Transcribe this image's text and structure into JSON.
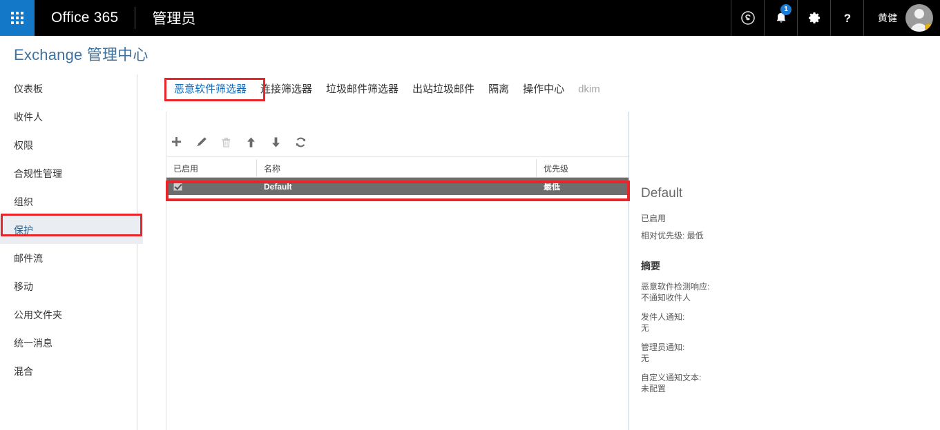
{
  "topbar": {
    "waffle_label": "app-launcher",
    "brand": "Office 365",
    "subbrand": "管理员",
    "icons": [
      {
        "name": "skype-icon",
        "label": "Skype"
      },
      {
        "name": "bell-icon",
        "label": "通知",
        "badge": "1"
      },
      {
        "name": "gear-icon",
        "label": "设置"
      },
      {
        "name": "help-icon",
        "label": "帮助"
      }
    ],
    "username": "黄健"
  },
  "page": {
    "title": "Exchange 管理中心"
  },
  "sidebar": {
    "items": [
      {
        "label": "仪表板",
        "active": false
      },
      {
        "label": "收件人",
        "active": false
      },
      {
        "label": "权限",
        "active": false
      },
      {
        "label": "合规性管理",
        "active": false
      },
      {
        "label": "组织",
        "active": false
      },
      {
        "label": "保护",
        "active": true
      },
      {
        "label": "邮件流",
        "active": false
      },
      {
        "label": "移动",
        "active": false
      },
      {
        "label": "公用文件夹",
        "active": false
      },
      {
        "label": "统一消息",
        "active": false
      },
      {
        "label": "混合",
        "active": false
      }
    ]
  },
  "tabs": [
    {
      "label": "恶意软件筛选器",
      "state": "active"
    },
    {
      "label": "连接筛选器",
      "state": "normal"
    },
    {
      "label": "垃圾邮件筛选器",
      "state": "normal"
    },
    {
      "label": "出站垃圾邮件",
      "state": "normal"
    },
    {
      "label": "隔离",
      "state": "normal"
    },
    {
      "label": "操作中心",
      "state": "normal"
    },
    {
      "label": "dkim",
      "state": "muted"
    }
  ],
  "toolbar": {
    "buttons": [
      {
        "name": "add-button",
        "icon": "plus-icon",
        "label": "新建",
        "disabled": false
      },
      {
        "name": "edit-button",
        "icon": "pencil-icon",
        "label": "编辑",
        "disabled": false
      },
      {
        "name": "delete-button",
        "icon": "trash-icon",
        "label": "删除",
        "disabled": true
      },
      {
        "name": "move-up-button",
        "icon": "arrow-up-icon",
        "label": "上移",
        "disabled": false
      },
      {
        "name": "move-down-button",
        "icon": "arrow-down-icon",
        "label": "下移",
        "disabled": false
      },
      {
        "name": "refresh-button",
        "icon": "refresh-icon",
        "label": "刷新",
        "disabled": false
      }
    ]
  },
  "table": {
    "columns": [
      "已启用",
      "名称",
      "优先级"
    ],
    "rows": [
      {
        "enabled": true,
        "name": "Default",
        "priority": "最低",
        "selected": true
      }
    ]
  },
  "detail": {
    "title": "Default",
    "enabled_text": "已启用",
    "priority_text": "相对优先级: 最低",
    "summary_heading": "摘要",
    "fields": [
      {
        "key": "恶意软件检测响应:",
        "value": "不通知收件人"
      },
      {
        "key": "发件人通知:",
        "value": "无"
      },
      {
        "key": "管理员通知:",
        "value": "无"
      },
      {
        "key": "自定义通知文本:",
        "value": "未配置"
      }
    ]
  },
  "colors": {
    "topbar_bg": "#000000",
    "waffle_bg": "#1478c9",
    "accent_blue": "#0f6cbd",
    "title_blue": "#41729d",
    "annotation_red": "#e8262a",
    "row_selected_bg": "#6d6d6d",
    "nav_active_bg": "#eaeef2"
  }
}
